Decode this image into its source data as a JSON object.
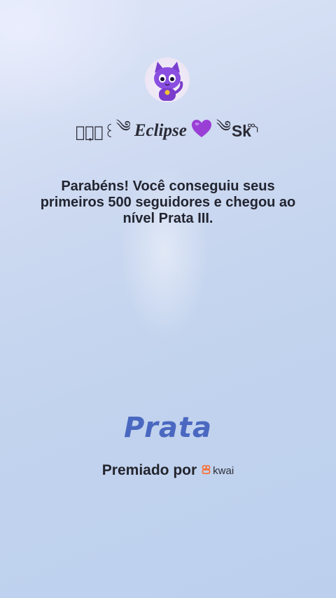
{
  "profile": {
    "avatar_icon": "purple-cat-avatar-icon",
    "username_prefix": "⸙͎۪۫꒰",
    "username_swirl": "༄",
    "username_name": "Eclipse",
    "username_emoji": "purple-heart-icon",
    "username_suffix_swirl": "༄",
    "username_tag": "Sk",
    "username_end": "᪲⸃"
  },
  "message": {
    "text": "Parabéns! Você conseguiu seus primeiros 500 seguidores e chegou ao nível Prata III."
  },
  "level": {
    "name": "Prata"
  },
  "awarded": {
    "label": "Premiado por",
    "brand": "kwai",
    "brand_color": "#ff6a2a"
  },
  "colors": {
    "level_text": "#4a68c0",
    "heart": "#9a3fd6"
  }
}
